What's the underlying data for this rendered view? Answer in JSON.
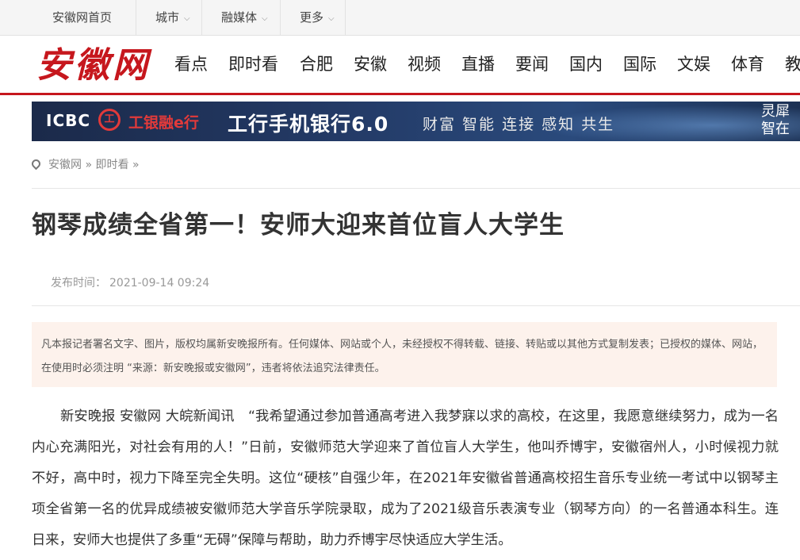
{
  "topbar": {
    "home": "安徽网首页",
    "city": "城市",
    "media": "融媒体",
    "more": "更多"
  },
  "header": {
    "logo_text": "安徽网",
    "nav": [
      "看点",
      "即时看",
      "合肥",
      "安徽",
      "视频",
      "直播",
      "要闻",
      "国内",
      "国际",
      "文娱",
      "体育",
      "教"
    ]
  },
  "banner": {
    "icbc": "ICBC",
    "coin": "工",
    "brand": "工银融e行",
    "main": "工行手机银行6.0",
    "slogan": "财富 智能 连接 感知 共生",
    "right_line1": "灵犀",
    "right_line2": "智在"
  },
  "breadcrumb": {
    "home": "安徽网",
    "sep1": "»",
    "section": "即时看",
    "sep2": "»"
  },
  "article": {
    "title": "钢琴成绩全省第一！安师大迎来首位盲人大学生",
    "pub_label": "发布时间：",
    "pub_time": "2021-09-14 09:24",
    "notice": "凡本报记者署名文字、图片，版权均属新安晚报所有。任何媒体、网站或个人，未经授权不得转载、链接、转贴或以其他方式复制发表；已授权的媒体、网站，在使用时必须注明 “来源：新安晚报或安徽网”，违者将依法追究法律责任。",
    "body": "新安晚报 安徽网 大皖新闻讯　“我希望通过参加普通高考进入我梦寐以求的高校，在这里，我愿意继续努力，成为一名内心充满阳光，对社会有用的人！”日前，安徽师范大学迎来了首位盲人大学生，他叫乔博宇，安徽宿州人，小时候视力就不好，高中时，视力下降至完全失明。这位“硬核”自强少年，在2021年安徽省普通高校招生音乐专业统一考试中以钢琴主项全省第一名的优异成绩被安徽师范大学音乐学院录取，成为了2021级音乐表演专业（钢琴方向）的一名普通本科生。连日来，安师大也提供了多重“无碍”保障与帮助，助力乔博宇尽快适应大学生活。"
  },
  "colors": {
    "brand_red": "#c6171d",
    "notice_bg": "#fdf2ec"
  }
}
